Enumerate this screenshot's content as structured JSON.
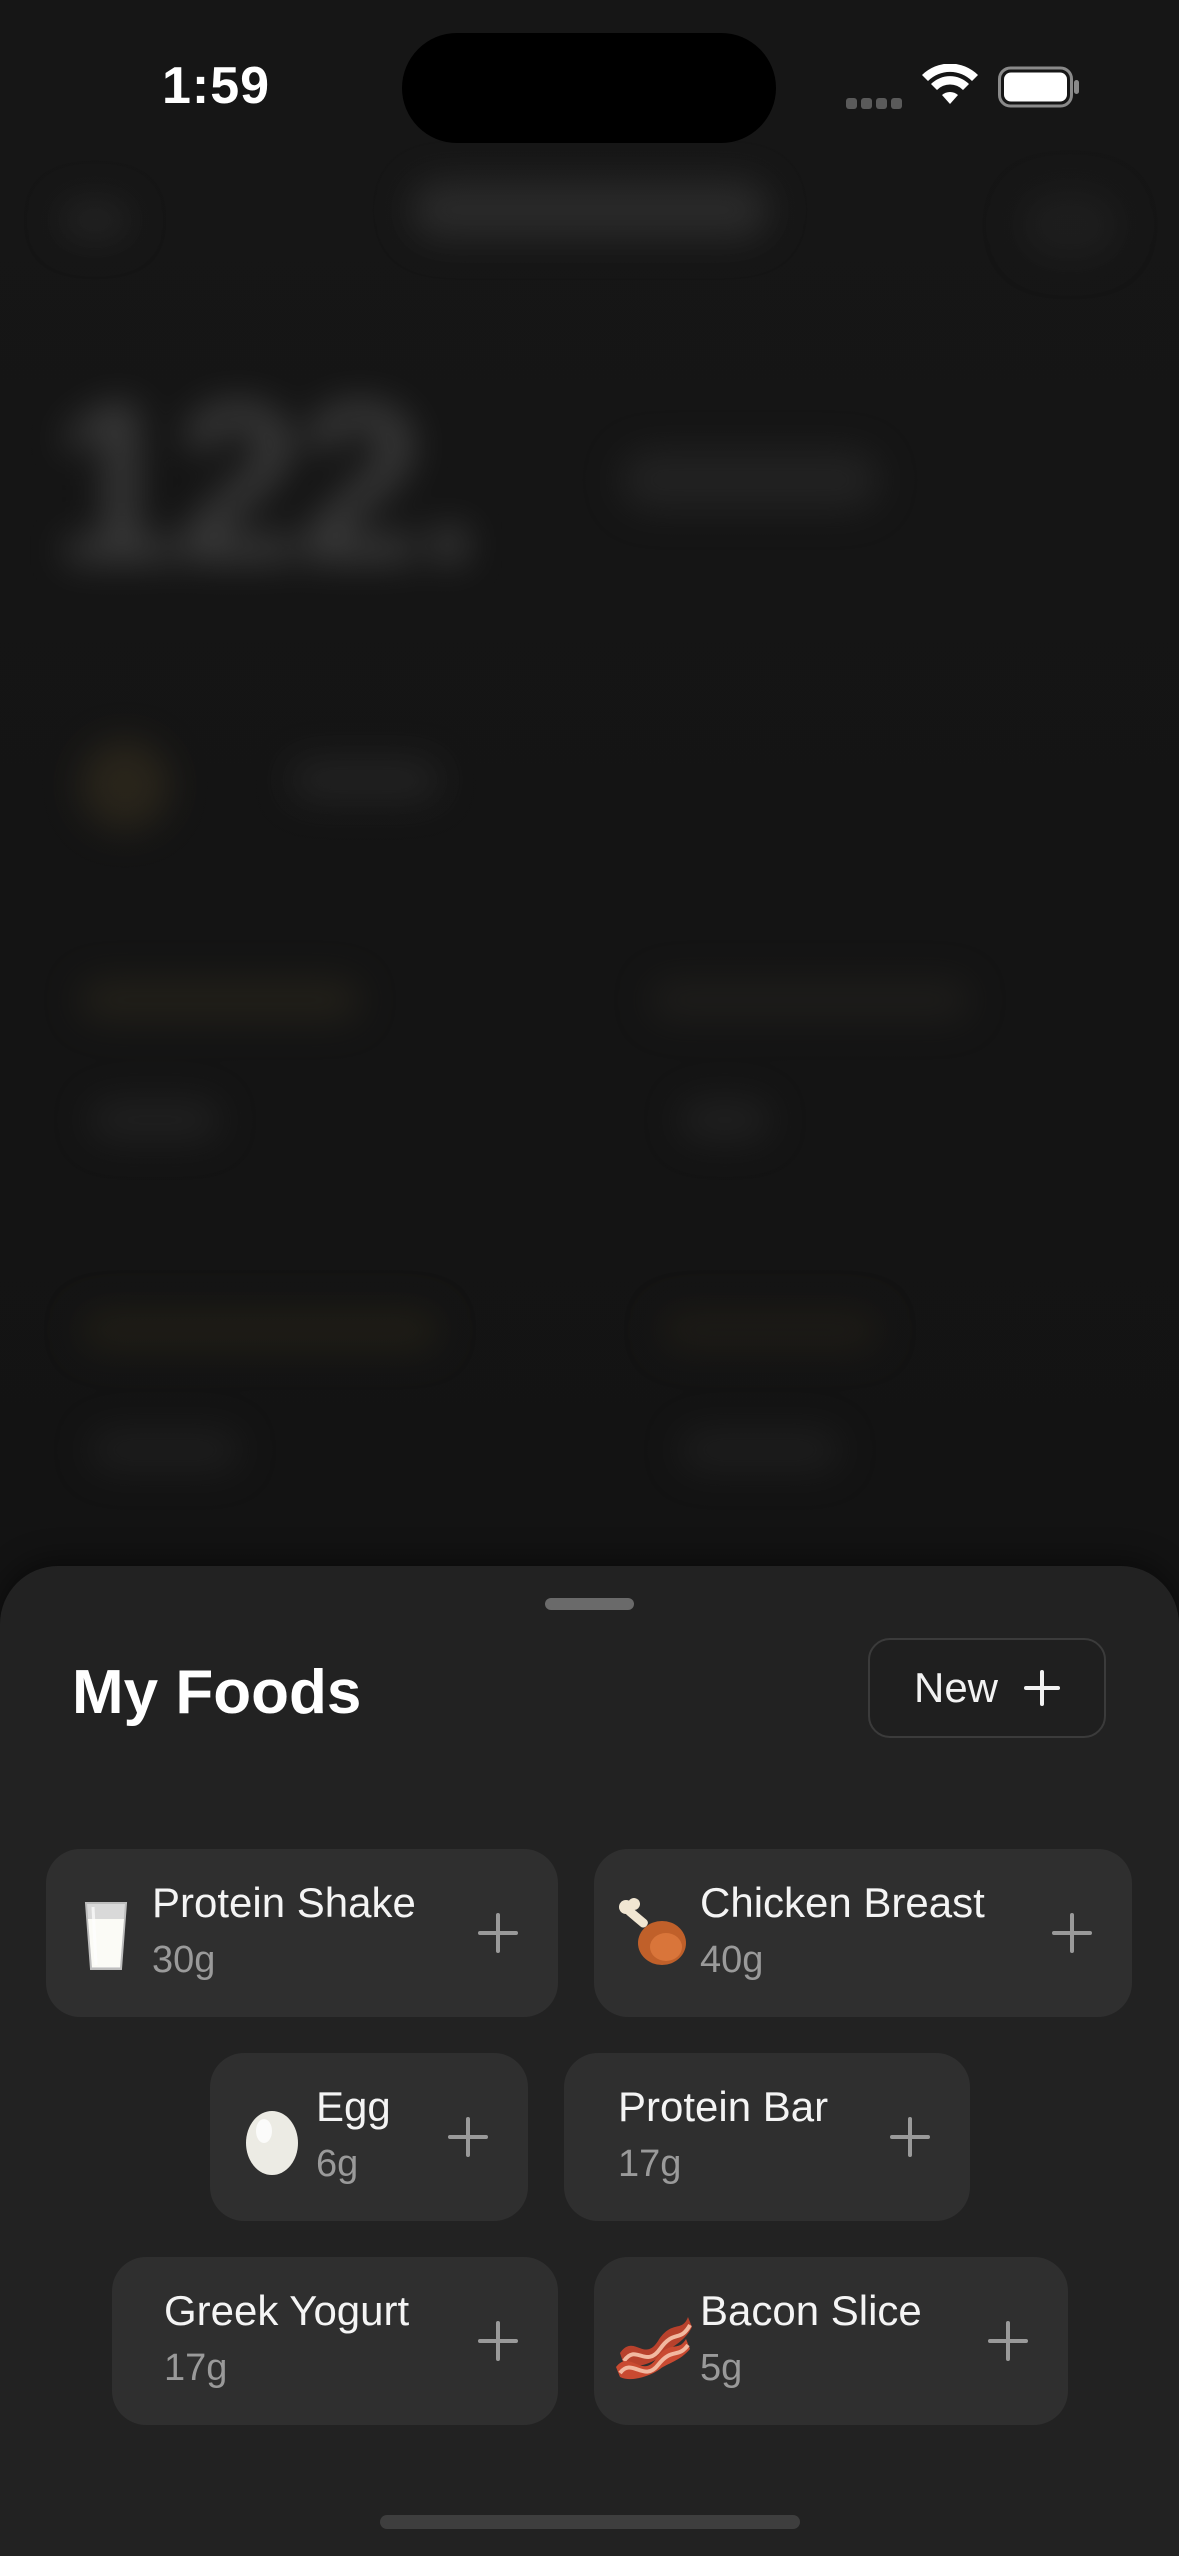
{
  "status_bar": {
    "time": "1:59"
  },
  "background": {
    "big_number": "122."
  },
  "sheet": {
    "title": "My Foods",
    "new_button_label": "New"
  },
  "foods": [
    {
      "name": "Protein Shake",
      "amount": "30g",
      "icon": "milk-glass-icon"
    },
    {
      "name": "Chicken Breast",
      "amount": "40g",
      "icon": "chicken-leg-icon"
    },
    {
      "name": "Egg",
      "amount": "6g",
      "icon": "egg-icon"
    },
    {
      "name": "Protein Bar",
      "amount": "17g",
      "icon": ""
    },
    {
      "name": "Greek Yogurt",
      "amount": "17g",
      "icon": ""
    },
    {
      "name": "Bacon Slice",
      "amount": "5g",
      "icon": "bacon-icon"
    }
  ],
  "colors": {
    "sheet_background": "#222222",
    "chip_background": "#2f2f2f",
    "secondary_text": "#9a9a9a"
  }
}
